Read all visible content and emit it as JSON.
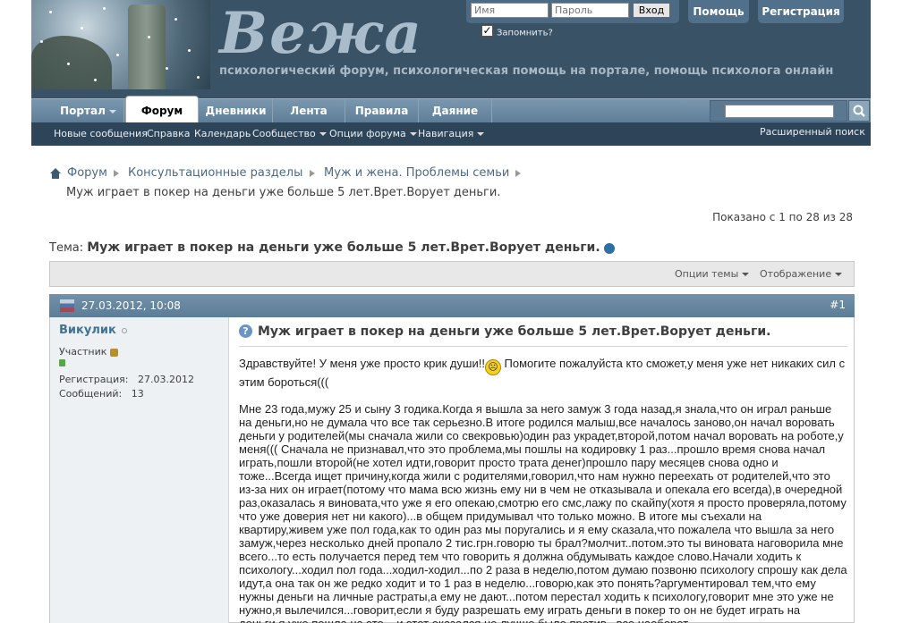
{
  "header": {
    "brand": "Вежа",
    "tagline": "психологический форум, психологическая помощь на портале, помощь психолога онлайн",
    "login": {
      "username_placeholder": "Имя",
      "password_placeholder": "Пароль",
      "login_button": "Вход",
      "remember_label": "Запомнить?",
      "remember_checked": true
    },
    "help_button": "Помощь",
    "register_button": "Регистрация"
  },
  "navbar": {
    "tabs": [
      {
        "label": "Портал",
        "has_menu": true,
        "active": false
      },
      {
        "label": "Форум",
        "has_menu": false,
        "active": true
      },
      {
        "label": "Дневники",
        "has_menu": false,
        "active": false
      },
      {
        "label": "Лента",
        "has_menu": false,
        "active": false
      },
      {
        "label": "Правила",
        "has_menu": false,
        "active": false
      },
      {
        "label": "Даяние",
        "has_menu": false,
        "active": false
      }
    ]
  },
  "subnav": {
    "items": [
      {
        "label": "Новые сообщения"
      },
      {
        "label": "Справка"
      },
      {
        "label": "Календарь"
      },
      {
        "label": "Сообщество"
      },
      {
        "label": "Опции форума"
      },
      {
        "label": "Навигация"
      }
    ],
    "advanced_search": "Расширенный поиск"
  },
  "breadcrumb": {
    "items": [
      "Форум",
      "Консультационные разделы",
      "Муж и жена. Проблемы семьи"
    ],
    "current": "Муж играет в покер на деньги уже больше 5 лет.Врет.Ворует деньги."
  },
  "pagination": {
    "shown_text": "Показано с 1 по 28 из 28"
  },
  "thread": {
    "label": "Тема:",
    "title": "Муж играет в покер на деньги уже больше 5 лет.Врет.Ворует деньги.",
    "options": "Опции темы",
    "display": "Отображение"
  },
  "post": {
    "date": "27.03.2012, 10:08",
    "number": "#1",
    "user": {
      "name": "Викулик",
      "title": "Участник",
      "reg_label": "Регистрация:",
      "reg_value": "27.03.2012",
      "posts_label": "Сообщений:",
      "posts_value": "13"
    },
    "title": "Муж играет в покер на деньги уже больше 5 лет.Врет.Ворует деньги.",
    "para1_a": "Здравствуйте! У меня уже просто крик души!!",
    "para1_b": " Помогите пожалуйста кто сможет,у меня уже нет никаких сил с этим бороться(((",
    "para2": "Мне 23 года,мужу 25 и сыну 3 годика.Когда я вышла за него замуж 3 года назад,я знала,что он играл раньше на деньги,но не думала что все так серьезно.В итоге родился малыш,все началось заново,он начал воровать деньги у родителей(мы сначала жили со свекровью)один раз украдет,второй,потом начал воровать на роботе,у меня((( Сначала не признавал,что это проблема,мы пошлы на кодировку 1 раз...прошло время снова начал играть,пошли второй(не хотел идти,говорит просто трата денег)прошло пару месяцев снова одно и тоже...Всегда ищет причину,когда жили с родителями,говорил,что нам нужно переехать от родителей,что это из-за них он играет(потому что мама всю жизнь ему ни в чем не отказывала и опекала его всегда),в очередной раз,оказалась я виновата,что уже я его опекаю,смотрю его смс,лажу по скайпу(хотя я просто проверяла,потому что уже доверия нет ни какого)...в общем придумывал что только можно. В итоге мы съехали на квартиру,живем уже пол года,как то один раз мы поругались и я ему сказала,что пожалела что вышла за него замуж,через несколько дней пропало 2 тис.грн.говорю ты брал?молчит..потом.это ты виновата наговорила мне всего...то есть получается перед тем что говорить я должна обдумывать каждое слово.Начали ходить к психологу...ходил пол года...ходил-ходил...по 2 раза в неделю,потом думаю позвоню психологу спрошу как дела идут,а она так он же редко ходит и то 1 раз в неделю...говорю,как это понять?аргументировал тем,что ему нужны деньги на личные растраты,а ему не дают...потом перестал ходить к психологу,говорит мне это уже не нужно,я вылечился...говорит,если я буду разрешать ему играть деньги в покер то он не будет играть на деньги,я уже пошла на это ...и этот оказался не лучше,было против...все наоборот..."
  },
  "colors": {
    "header_bg": "#3a5266",
    "nav_bg": "#6886a0",
    "subnav_bg": "#2e4559",
    "link": "#417394",
    "post_head": "#6887a0"
  }
}
